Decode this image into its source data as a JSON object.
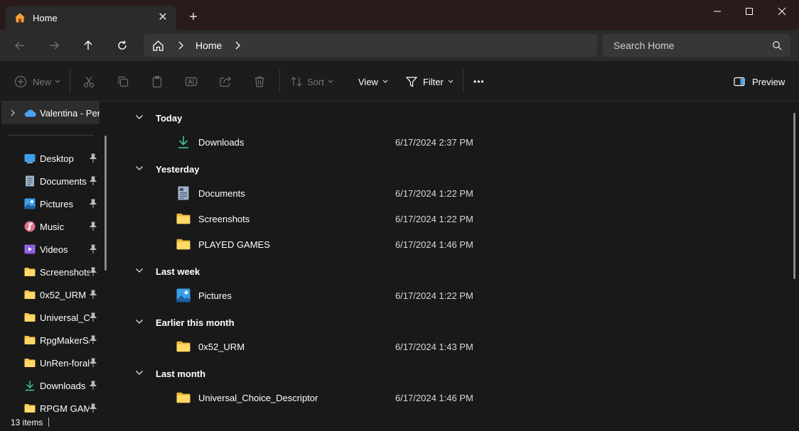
{
  "window": {
    "tab_title": "Home",
    "tab_close": "✕",
    "new_tab": "+",
    "minimize": "—",
    "close": "✕"
  },
  "nav": {
    "breadcrumb_current": "Home",
    "search_placeholder": "Search Home"
  },
  "toolbar": {
    "new_label": "New",
    "sort_label": "Sort",
    "view_label": "View",
    "filter_label": "Filter",
    "more_label": "•••",
    "preview_label": "Preview"
  },
  "sidebar": {
    "cloud_label": "Valentina - Personal",
    "items": [
      {
        "label": "Desktop",
        "icon": "desktop-icon"
      },
      {
        "label": "Documents",
        "icon": "documents-icon"
      },
      {
        "label": "Pictures",
        "icon": "pictures-icon"
      },
      {
        "label": "Music",
        "icon": "music-icon"
      },
      {
        "label": "Videos",
        "icon": "videos-icon"
      },
      {
        "label": "Screenshots",
        "icon": "folder-icon"
      },
      {
        "label": "0x52_URM",
        "icon": "folder-icon"
      },
      {
        "label": "Universal_Choice_Descriptor",
        "icon": "folder-icon"
      },
      {
        "label": "RpgMakerSaveEdit",
        "icon": "folder-icon"
      },
      {
        "label": "UnRen-forall",
        "icon": "folder-icon"
      },
      {
        "label": "Downloads",
        "icon": "downloads-icon"
      },
      {
        "label": "RPGM GAMES",
        "icon": "folder-icon"
      }
    ]
  },
  "groups": [
    {
      "label": "Today"
    },
    {
      "label": "Yesterday"
    },
    {
      "label": "Last week"
    },
    {
      "label": "Earlier this month"
    },
    {
      "label": "Last month"
    }
  ],
  "files": [
    {
      "name": "Downloads",
      "date": "6/17/2024 2:37 PM",
      "icon": "downloads-icon"
    },
    {
      "name": "Documents",
      "date": "6/17/2024 1:22 PM",
      "icon": "documents-icon"
    },
    {
      "name": "Screenshots",
      "date": "6/17/2024 1:22 PM",
      "icon": "folder-icon"
    },
    {
      "name": "PLAYED GAMES",
      "date": "6/17/2024 1:46 PM",
      "icon": "folder-icon"
    },
    {
      "name": "Pictures",
      "date": "6/17/2024 1:22 PM",
      "icon": "pictures-icon"
    },
    {
      "name": "0x52_URM",
      "date": "6/17/2024 1:43 PM",
      "icon": "folder-icon"
    },
    {
      "name": "Universal_Choice_Descriptor",
      "date": "6/17/2024 1:46 PM",
      "icon": "folder-icon"
    }
  ],
  "status": {
    "item_count": "13 items"
  },
  "colors": {
    "folder": "#f5c542",
    "accent_blue": "#4aa3f0",
    "downloads_green": "#3ec99a"
  }
}
